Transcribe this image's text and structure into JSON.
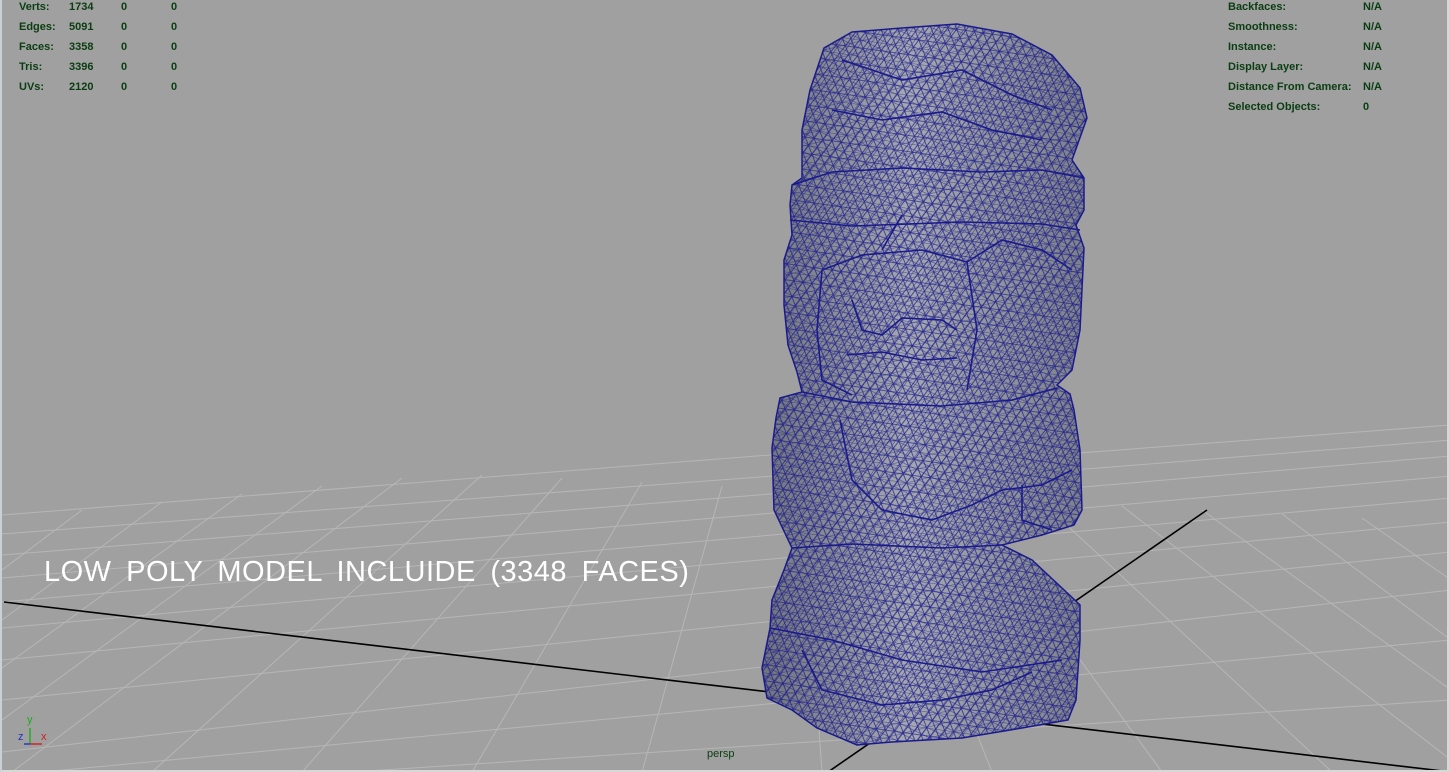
{
  "poly_count": [
    {
      "label": "Verts:",
      "v1": "1734",
      "v2": "0",
      "v3": "0"
    },
    {
      "label": "Edges:",
      "v1": "5091",
      "v2": "0",
      "v3": "0"
    },
    {
      "label": "Faces:",
      "v1": "3358",
      "v2": "0",
      "v3": "0"
    },
    {
      "label": "Tris:",
      "v1": "3396",
      "v2": "0",
      "v3": "0"
    },
    {
      "label": "UVs:",
      "v1": "2120",
      "v2": "0",
      "v3": "0"
    }
  ],
  "object_info": [
    {
      "label": "Backfaces:",
      "value": "N/A"
    },
    {
      "label": "Smoothness:",
      "value": "N/A"
    },
    {
      "label": "Instance:",
      "value": "N/A"
    },
    {
      "label": "Display Layer:",
      "value": "N/A"
    },
    {
      "label": "Distance From Camera:",
      "value": "N/A"
    },
    {
      "label": "Selected Objects:",
      "value": "0"
    }
  ],
  "overlay_caption": "LOW POLY MODEL INCLUIDE (3348 FACES)",
  "camera_name": "persp",
  "axis_labels": {
    "y": "y",
    "z": "z",
    "x": "x"
  },
  "colors": {
    "viewport_bg": "#a0a0a0",
    "hud_text": "#0a3d12",
    "wireframe": "#1a1a8c",
    "model_shade": "#8a8e96",
    "grid": "#b4b4b4",
    "axis_x": "#cc2020",
    "axis_y": "#20aa20",
    "axis_z": "#2030cc"
  }
}
